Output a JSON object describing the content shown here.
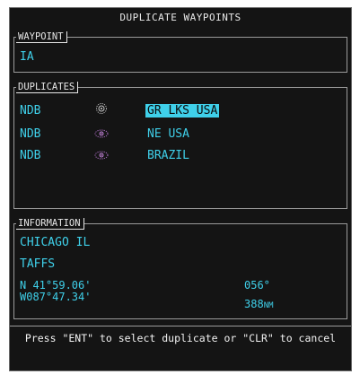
{
  "header": {
    "title": "DUPLICATE WAYPOINTS"
  },
  "waypoint": {
    "label": "WAYPOINT",
    "value": "IA"
  },
  "duplicates": {
    "label": "DUPLICATES",
    "rows": [
      {
        "type": "NDB",
        "icon": "ndb-icon",
        "location": "GR LKS USA",
        "selected": true
      },
      {
        "type": "NDB",
        "icon": "ndb-icon",
        "location": "NE USA",
        "selected": false
      },
      {
        "type": "NDB",
        "icon": "ndb-icon",
        "location": "BRAZIL",
        "selected": false
      }
    ]
  },
  "information": {
    "label": "INFORMATION",
    "city": "CHICAGO IL",
    "name": "TAFFS",
    "lat": "N 41°59.06'",
    "lon": "W087°47.34'",
    "bearing": "056°",
    "distance_value": "388",
    "distance_unit": "NM"
  },
  "footer": {
    "message": "Press \"ENT\" to select duplicate or \"CLR\" to cancel"
  },
  "colors": {
    "text_cyan": "#3fd0ea",
    "bg": "#141414",
    "border": "#9a9a9a"
  }
}
